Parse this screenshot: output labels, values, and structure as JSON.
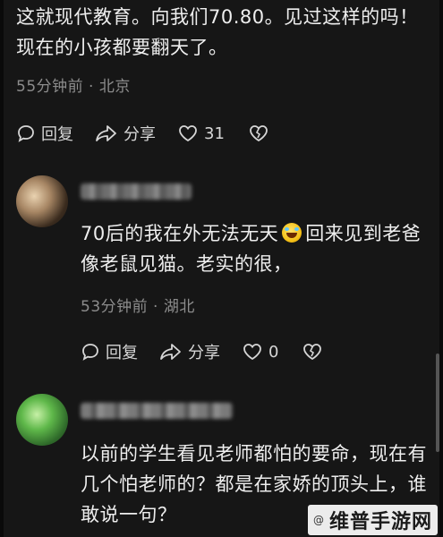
{
  "comment1": {
    "text": "这就现代教育。向我们70.80。见过这样的吗！现在的小孩都要翻天了。",
    "meta": "55分钟前 · 北京",
    "actions": {
      "reply": "回复",
      "share": "分享",
      "likes": "31"
    }
  },
  "reply1": {
    "text_before_emoji": "70后的我在外无法无天",
    "text_after_emoji": "回来见到老爸像老鼠见猫。老实的很，",
    "emoji": "rolling-on-floor-laughing-emoji",
    "meta": "53分钟前 · 湖北",
    "actions": {
      "reply": "回复",
      "share": "分享",
      "likes": "0"
    }
  },
  "reply2": {
    "text": "以前的学生看见老师都怕的要命，现在有几个怕老师的？都是在家娇的顶头上，谁敢说一句？"
  },
  "watermark": {
    "small": "@",
    "big": "维普手游网"
  }
}
